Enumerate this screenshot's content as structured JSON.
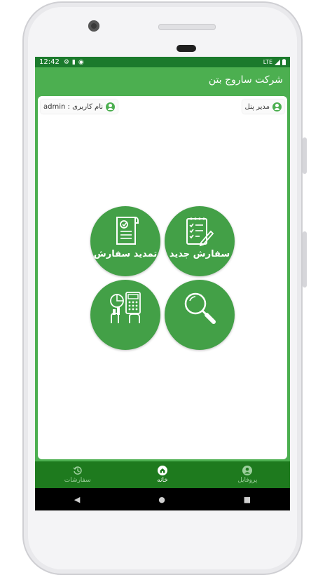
{
  "status_bar": {
    "time": "12:42",
    "network": "LTE"
  },
  "app_bar": {
    "title": "شرکت ساروج بتن"
  },
  "header": {
    "left_chip_label": "نام کاربری : admin",
    "right_chip_label": "مدیر پنل"
  },
  "tiles": [
    {
      "label": "سفارش جدید",
      "icon": "new-order-checklist-icon"
    },
    {
      "label": "تمدید سفارش",
      "icon": "renew-order-document-icon"
    },
    {
      "label": "",
      "icon": "search-magnifier-icon"
    },
    {
      "label": "",
      "icon": "calculator-chart-icon"
    }
  ],
  "bottom_nav": {
    "items": [
      {
        "label": "سفارشات",
        "icon": "history-icon"
      },
      {
        "label": "خانه",
        "icon": "home-icon",
        "active": true
      },
      {
        "label": "پروفایل",
        "icon": "profile-icon"
      }
    ]
  },
  "colors": {
    "primary": "#4caf50",
    "primary_dark": "#1b7a2c",
    "tile": "#43a047",
    "nav_bg": "#1e7a1e"
  }
}
